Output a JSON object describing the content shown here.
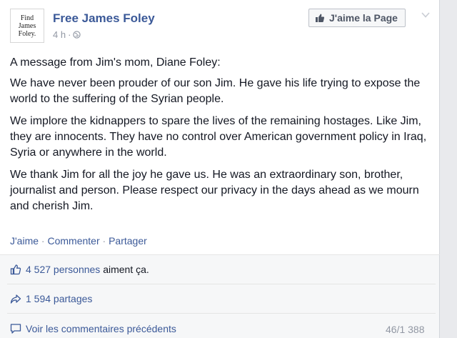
{
  "post": {
    "logo_lines": [
      "Find",
      "James",
      "Foley."
    ],
    "page_name": "Free James Foley",
    "time": "4 h",
    "separator": "·",
    "like_page_label": "J'aime la Page",
    "paragraphs": [
      "A message from Jim's mom, Diane Foley:",
      "We have never been prouder of our son Jim. He gave his life trying to expose the world to the suffering of the Syrian people.",
      "We implore the kidnappers to spare the lives of the remaining hostages. Like Jim, they are innocents. They have no control over American government policy in Iraq, Syria or anywhere in the world.",
      "We thank Jim for all the joy he gave us. He was an extraordinary son, brother, journalist and person. Please respect our privacy in the days ahead as we mourn and cherish Jim."
    ]
  },
  "actions": {
    "like": "J'aime",
    "comment": "Commenter",
    "share": "Partager",
    "dot": " · "
  },
  "stats": {
    "likes_count": "4 527 personnes",
    "likes_suffix": " aiment ça.",
    "shares": "1 594 partages",
    "view_comments": "Voir les commentaires précédents",
    "comment_count": "46/1 388"
  },
  "colors": {
    "link": "#3b5998",
    "text": "#141823",
    "muted": "#9197a3"
  },
  "icons": {
    "like_page": "thumbs-up-icon",
    "privacy": "globe-icon",
    "options": "chevron-down-icon",
    "likes": "thumbs-up-outline-icon",
    "shares": "share-arrow-icon",
    "comments": "comment-bubble-icon"
  }
}
